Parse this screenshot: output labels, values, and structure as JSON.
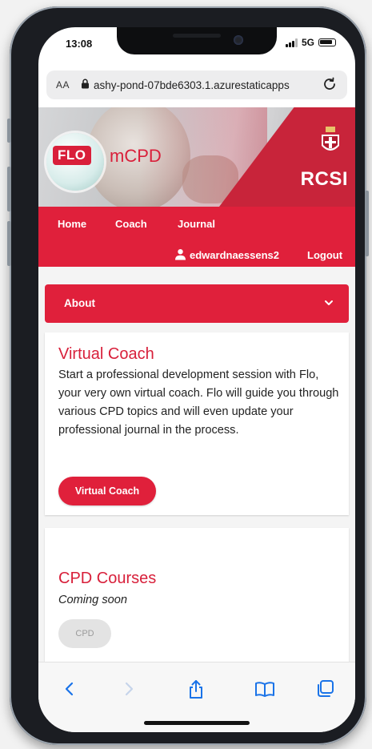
{
  "status": {
    "time": "13:08",
    "network": "5G"
  },
  "browser": {
    "aa_label": "AA",
    "url": "ashy-pond-07bde6303.1.azurestaticapps",
    "reload_icon": "reload-icon"
  },
  "header": {
    "logo_flo": "FLO",
    "logo_mcpd": "mCPD",
    "org": "RCSI"
  },
  "nav": {
    "home": "Home",
    "coach": "Coach",
    "journal": "Journal",
    "username": "edwardnaessens2",
    "logout": "Logout"
  },
  "about": {
    "label": "About"
  },
  "cards": {
    "coach": {
      "title": "Virtual Coach",
      "text": "Start a professional development session with Flo, your very own virtual coach. Flo will guide you through various CPD topics and will even update your professional journal in the process.",
      "button": "Virtual Coach"
    },
    "courses": {
      "title": "CPD Courses",
      "subtitle": "Coming soon",
      "button": "CPD"
    }
  },
  "colors": {
    "brand_red": "#e0203b",
    "link_blue": "#1a73e8"
  }
}
